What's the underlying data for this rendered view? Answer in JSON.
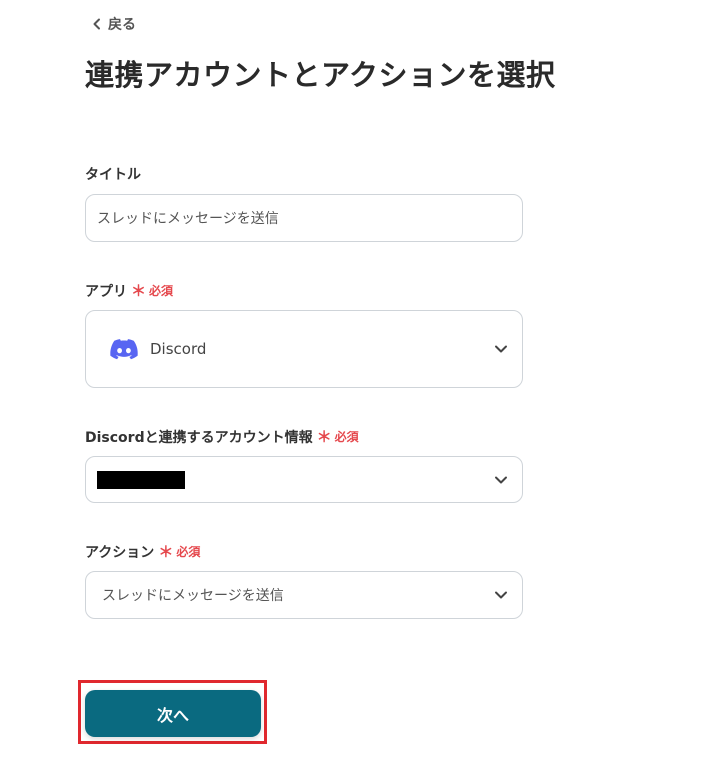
{
  "header": {
    "back_label": "戻る",
    "title": "連携アカウントとアクションを選択"
  },
  "form": {
    "title_field": {
      "label": "タイトル",
      "value": "スレッドにメッセージを送信"
    },
    "app_field": {
      "label": "アプリ",
      "required_mark": "＊",
      "required_text": "必須",
      "selected_app": "Discord",
      "app_icon": "discord-logo-icon",
      "app_color": "#5865F2"
    },
    "account_field": {
      "label": "Discordと連携するアカウント情報",
      "required_mark": "＊",
      "required_text": "必須"
    },
    "action_field": {
      "label": "アクション",
      "required_mark": "＊",
      "required_text": "必須",
      "value": "スレッドにメッセージを送信"
    }
  },
  "footer": {
    "next_label": "次へ",
    "next_color": "#0a6a80",
    "highlight_color": "#e0282e"
  }
}
